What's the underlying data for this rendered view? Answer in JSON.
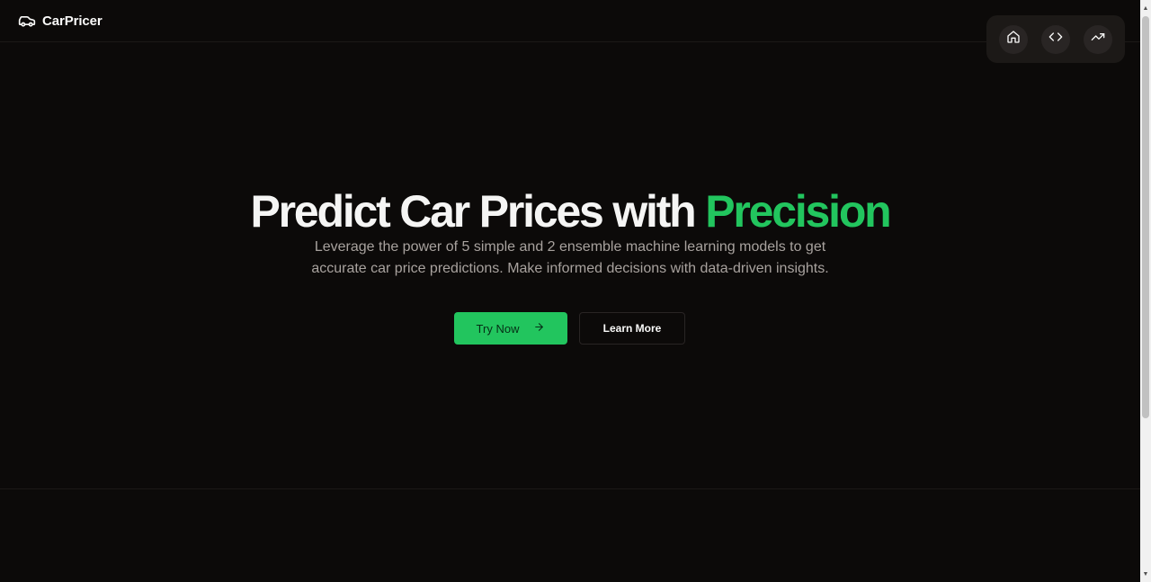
{
  "header": {
    "brand": "CarPricer",
    "logo_icon": "car-icon"
  },
  "nav": {
    "items": [
      {
        "icon": "home-icon"
      },
      {
        "icon": "code-icon"
      },
      {
        "icon": "trending-up-icon"
      }
    ]
  },
  "hero": {
    "headline_main": "Predict Car Prices with ",
    "headline_accent": "Precision",
    "subtitle": "Leverage the power of 5 simple and 2 ensemble machine learning models to get accurate car price predictions. Make informed decisions with data-driven insights.",
    "primary_button": "Try Now",
    "primary_button_icon": "arrow-right-icon",
    "secondary_button": "Learn More"
  },
  "colors": {
    "background": "#0c0a09",
    "accent": "#22c55e",
    "text": "#fafaf9",
    "muted": "#a8a29e"
  }
}
